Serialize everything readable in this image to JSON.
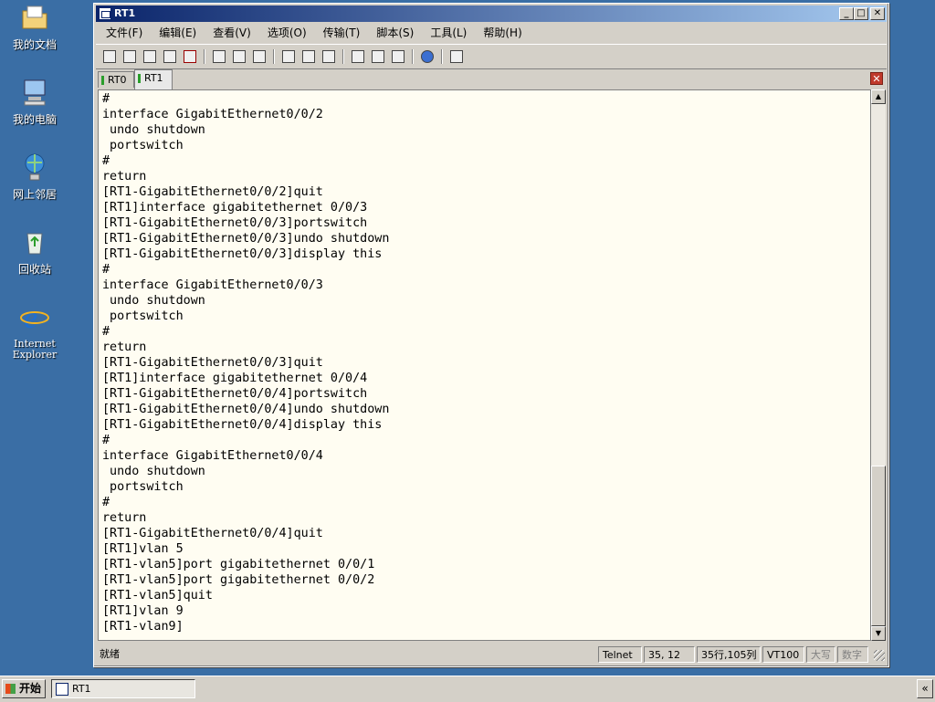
{
  "desktop": {
    "icons": [
      {
        "label": "我的文档",
        "icon": "my-documents-icon"
      },
      {
        "label": "我的电脑",
        "icon": "my-computer-icon"
      },
      {
        "label": "网上邻居",
        "icon": "network-places-icon"
      },
      {
        "label": "回收站",
        "icon": "recycle-bin-icon"
      },
      {
        "label": "Internet Explorer",
        "icon": "internet-explorer-icon"
      }
    ]
  },
  "window": {
    "title": "RT1",
    "menu": [
      "文件(F)",
      "编辑(E)",
      "查看(V)",
      "选项(O)",
      "传输(T)",
      "脚本(S)",
      "工具(L)",
      "帮助(H)"
    ],
    "tabs": [
      {
        "label": "RT0",
        "active": false
      },
      {
        "label": "RT1",
        "active": true
      }
    ],
    "terminal_lines": [
      "#",
      "interface GigabitEthernet0/0/2",
      " undo shutdown",
      " portswitch",
      "#",
      "return",
      "[RT1-GigabitEthernet0/0/2]quit",
      "[RT1]interface gigabitethernet 0/0/3",
      "[RT1-GigabitEthernet0/0/3]portswitch",
      "[RT1-GigabitEthernet0/0/3]undo shutdown",
      "[RT1-GigabitEthernet0/0/3]display this",
      "#",
      "interface GigabitEthernet0/0/3",
      " undo shutdown",
      " portswitch",
      "#",
      "return",
      "[RT1-GigabitEthernet0/0/3]quit",
      "[RT1]interface gigabitethernet 0/0/4",
      "[RT1-GigabitEthernet0/0/4]portswitch",
      "[RT1-GigabitEthernet0/0/4]undo shutdown",
      "[RT1-GigabitEthernet0/0/4]display this",
      "#",
      "interface GigabitEthernet0/0/4",
      " undo shutdown",
      " portswitch",
      "#",
      "return",
      "[RT1-GigabitEthernet0/0/4]quit",
      "[RT1]vlan 5",
      "[RT1-vlan5]port gigabitethernet 0/0/1",
      "[RT1-vlan5]port gigabitethernet 0/0/2",
      "[RT1-vlan5]quit",
      "[RT1]vlan 9",
      "[RT1-vlan9]"
    ],
    "status": {
      "ready": "就绪",
      "protocol": "Telnet",
      "cursor": "35,   12",
      "position": "35行,105列",
      "terminal_type": "VT100",
      "caps": "大写",
      "num": "数字"
    }
  },
  "taskbar": {
    "start_label": "开始",
    "task_label": "RT1",
    "tray_label": "«"
  }
}
